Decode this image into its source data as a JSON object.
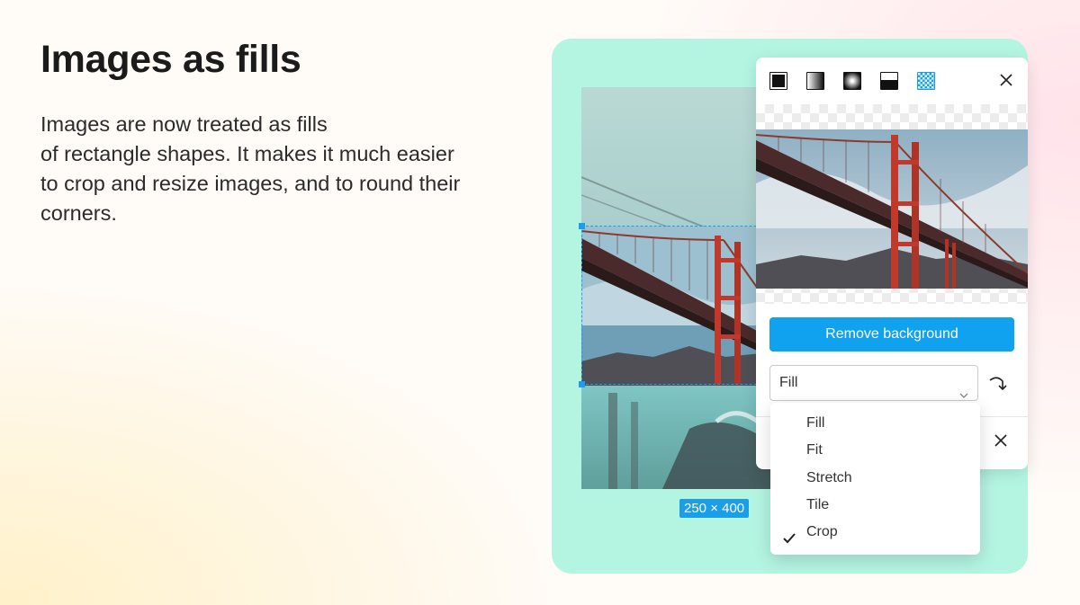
{
  "headline": "Images as fills",
  "description_lines": [
    "Images are now treated as fills",
    "of rectangle shapes. It makes it much easier",
    "to crop and resize images, and to round their",
    "corners."
  ],
  "canvas": {
    "size_badge": "250 × 400"
  },
  "fill_panel": {
    "fill_types": [
      "solid-fill-icon",
      "linear-gradient-icon",
      "radial-gradient-icon",
      "image-fill-icon",
      "pattern-fill-icon"
    ],
    "active_fill_type": "pattern-fill-icon",
    "remove_background_label": "Remove background",
    "scale_mode": {
      "selected": "Fill",
      "options": [
        "Fill",
        "Fit",
        "Stretch",
        "Tile",
        "Crop"
      ],
      "checked_option": "Crop"
    }
  },
  "colors": {
    "accent": "#10a2ee",
    "stage_bg": "#b4f5e1",
    "selection": "#1d9bf0"
  }
}
